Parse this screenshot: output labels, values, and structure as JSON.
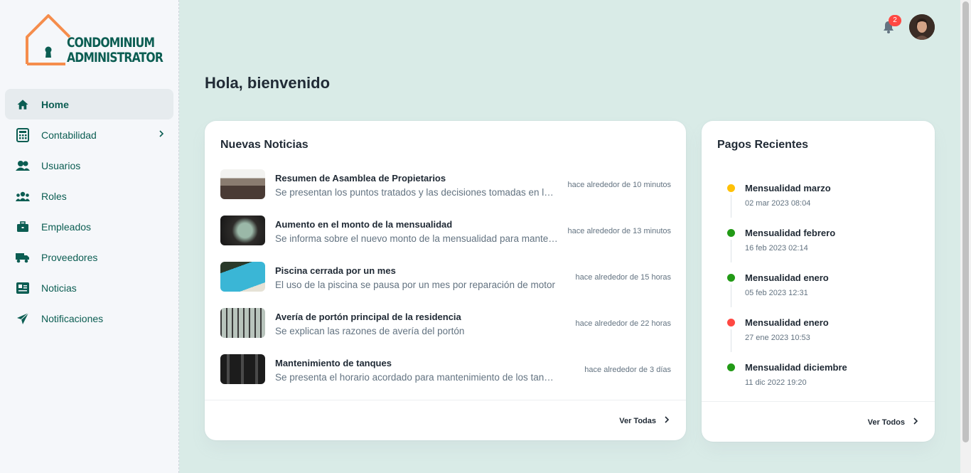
{
  "brand": {
    "line1": "CONDOMINIUM",
    "line2": "ADMINISTRATOR",
    "color": "#0b5d52",
    "accent": "#f58d4c"
  },
  "sidebar": {
    "items": [
      {
        "label": "Home",
        "icon": "home-icon",
        "active": true
      },
      {
        "label": "Contabilidad",
        "icon": "calculator-icon",
        "has_children": true
      },
      {
        "label": "Usuarios",
        "icon": "users-icon"
      },
      {
        "label": "Roles",
        "icon": "group-icon"
      },
      {
        "label": "Empleados",
        "icon": "briefcase-icon"
      },
      {
        "label": "Proveedores",
        "icon": "truck-icon"
      },
      {
        "label": "Noticias",
        "icon": "newspaper-icon"
      },
      {
        "label": "Notificaciones",
        "icon": "send-icon"
      }
    ]
  },
  "header": {
    "notification_count": "2",
    "bell_icon": "bell-icon",
    "avatar": "user-avatar"
  },
  "greeting": "Hola, bienvenido",
  "news": {
    "title": "Nuevas Noticias",
    "items": [
      {
        "title": "Resumen de Asamblea de Propietarios",
        "desc": "Se presentan los puntos tratados y las decisiones tomadas en la última asamblea",
        "time": "hace alrededor de 10 minutos"
      },
      {
        "title": "Aumento en el monto de la mensualidad",
        "desc": "Se informa sobre el nuevo monto de la mensualidad para mantenimiento",
        "time": "hace alrededor de 13 minutos"
      },
      {
        "title": "Piscina cerrada por un mes",
        "desc": "El uso de la piscina se pausa por un mes por reparación de motor",
        "time": "hace alrededor de 15 horas"
      },
      {
        "title": "Avería de portón principal de la residencia",
        "desc": "Se explican las razones de avería del portón",
        "time": "hace alrededor de 22 horas"
      },
      {
        "title": "Mantenimiento de tanques",
        "desc": "Se presenta el horario acordado para mantenimiento de los tanques",
        "time": "hace alrededor de 3 días"
      }
    ],
    "view_all": "Ver Todas"
  },
  "payments": {
    "title": "Pagos Recientes",
    "items": [
      {
        "title": "Mensualidad marzo",
        "date": "02 mar 2023 08:04",
        "color": "#ffc107"
      },
      {
        "title": "Mensualidad febrero",
        "date": "16 feb 2023 02:14",
        "color": "#229a16"
      },
      {
        "title": "Mensualidad enero",
        "date": "05 feb 2023 12:31",
        "color": "#229a16"
      },
      {
        "title": "Mensualidad enero",
        "date": "27 ene 2023 10:53",
        "color": "#ff4842"
      },
      {
        "title": "Mensualidad diciembre",
        "date": "11 dic 2022 19:20",
        "color": "#229a16"
      }
    ],
    "view_all": "Ver Todos"
  }
}
